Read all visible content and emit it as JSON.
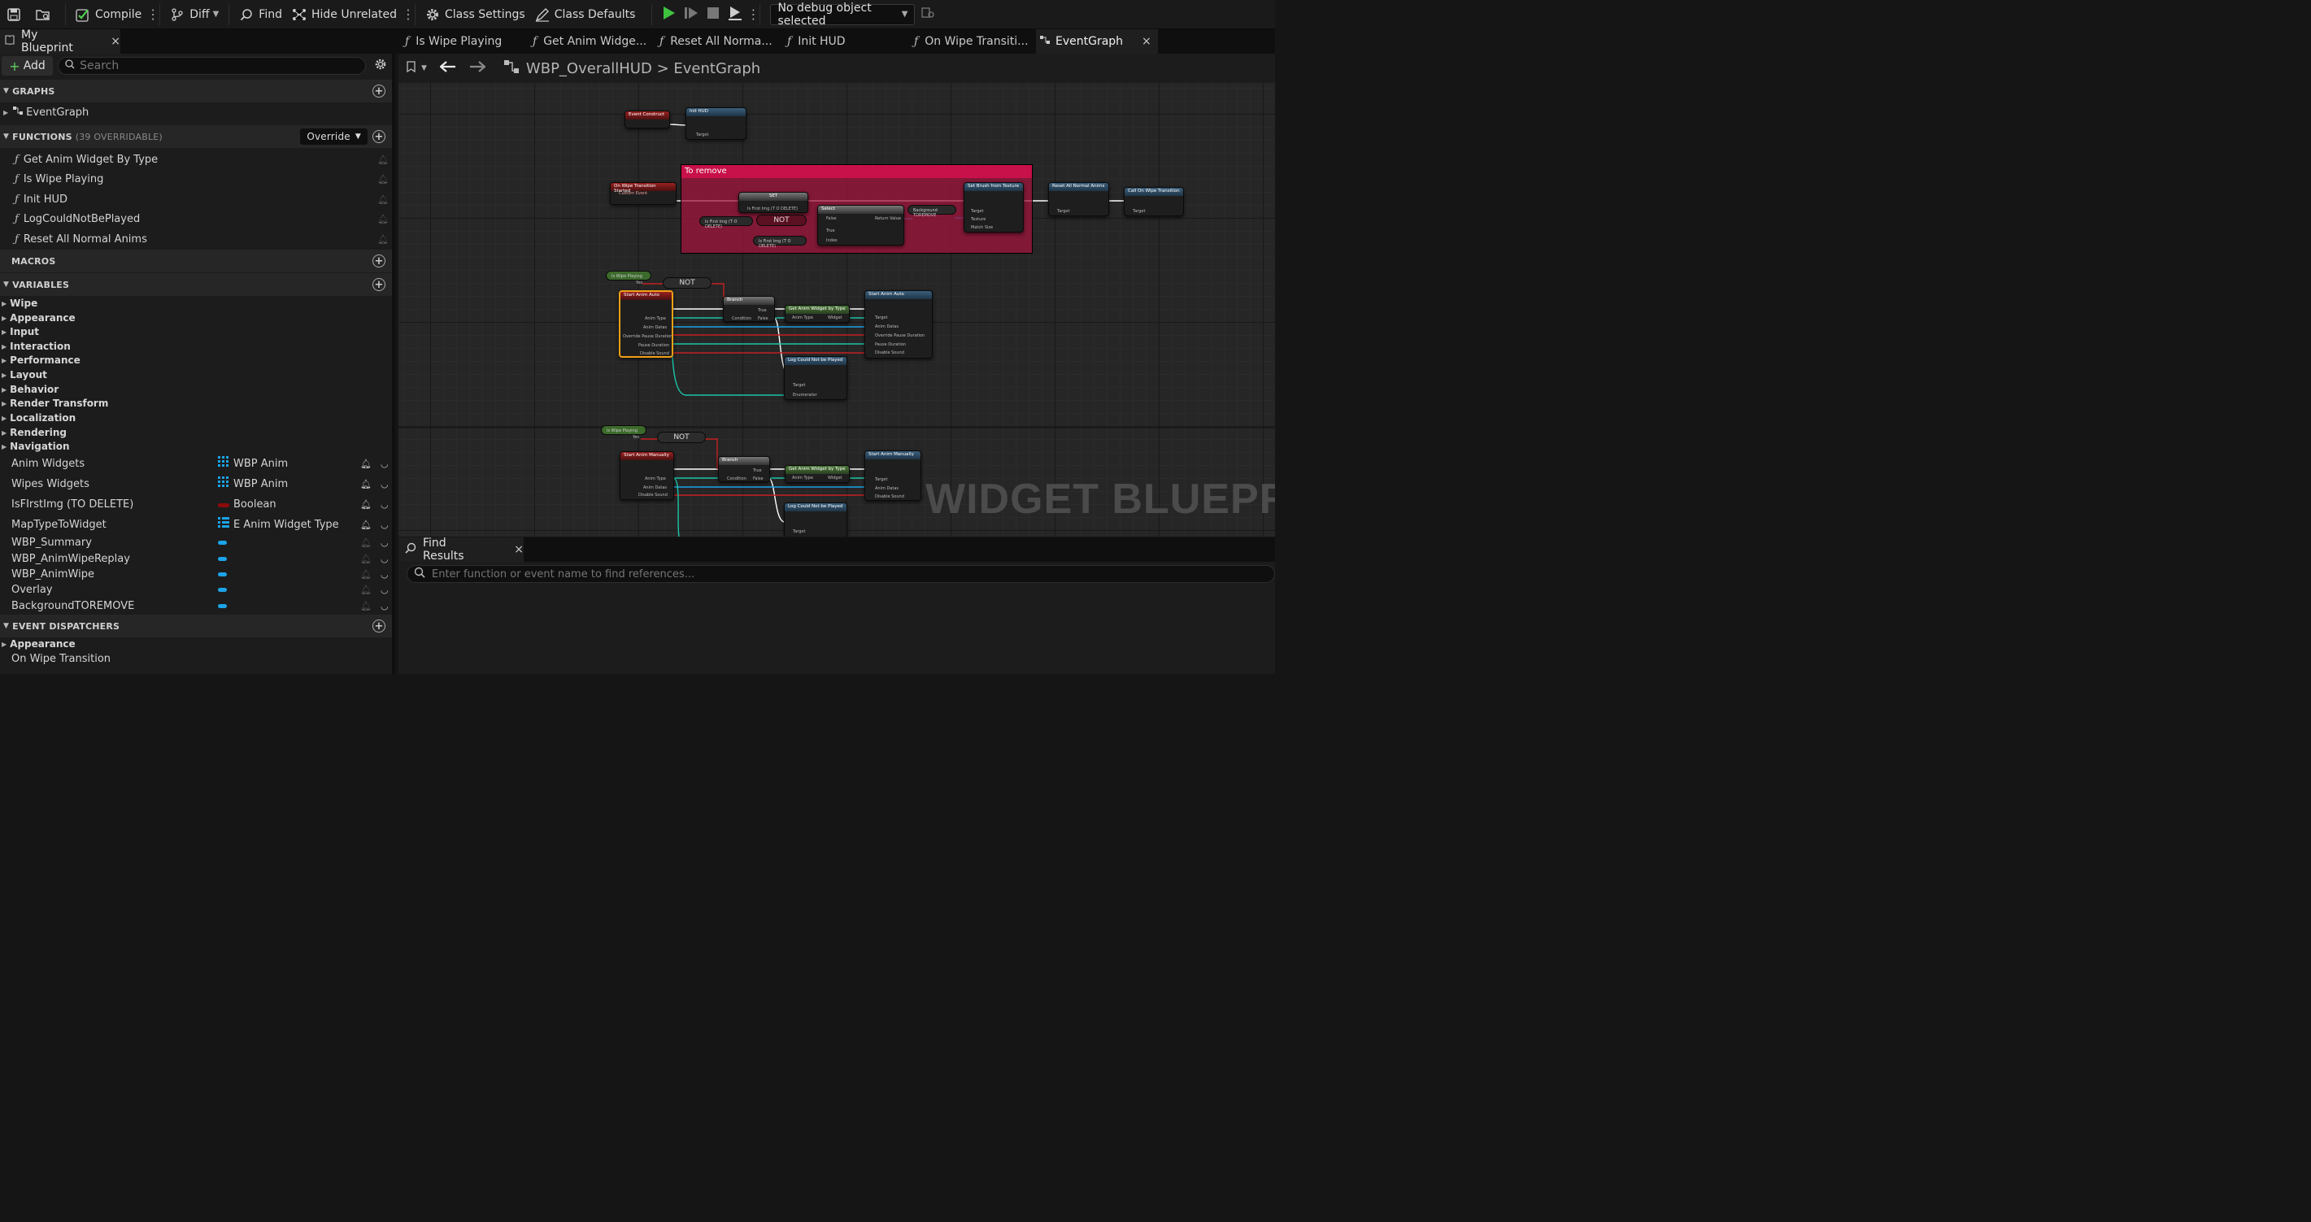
{
  "toolbar": {
    "compile": "Compile",
    "diff": "Diff",
    "find": "Find",
    "hide_unrelated": "Hide Unrelated",
    "class_settings": "Class Settings",
    "class_defaults": "Class Defaults",
    "debug_object": "No debug object selected"
  },
  "tabs": {
    "my_blueprint": "My Blueprint",
    "docs": [
      "Is Wipe Playing",
      "Get Anim Widge...",
      "Reset All Norma...",
      "Init HUD",
      "On Wipe Transiti...",
      "EventGraph"
    ]
  },
  "left": {
    "add": "Add",
    "search_placeholder": "Search",
    "graphs_header": "GRAPHS",
    "graphs": [
      "EventGraph"
    ],
    "functions_header": "FUNCTIONS",
    "functions_sub": "(39 OVERRIDABLE)",
    "override": "Override",
    "functions": [
      "Get Anim Widget By Type",
      "Is Wipe Playing",
      "Init HUD",
      "LogCouldNotBePlayed",
      "Reset All Normal Anims"
    ],
    "macros_header": "MACROS",
    "variables_header": "VARIABLES",
    "categories": [
      "Wipe",
      "Appearance",
      "Input",
      "Interaction",
      "Performance",
      "Layout",
      "Behavior",
      "Render Transform",
      "Localization",
      "Rendering",
      "Navigation"
    ],
    "variables": [
      {
        "name": "Anim Widgets",
        "type": "WBP Anim",
        "icon": "grid-icon",
        "color": "#1ba4e8"
      },
      {
        "name": "Wipes Widgets",
        "type": "WBP Anim",
        "icon": "grid-icon",
        "color": "#1ba4e8"
      },
      {
        "name": "IsFIrstImg (TO DELETE)",
        "type": "Boolean",
        "icon": "bool-pill",
        "color": "#8c0a0a"
      },
      {
        "name": "MapTypeToWidget",
        "type": "E Anim Widget Type",
        "icon": "map-icon",
        "color": "#1ba4e8"
      },
      {
        "name": "WBP_Summary",
        "type": "",
        "icon": "pill",
        "color": "#1ba4e8"
      },
      {
        "name": "WBP_AnimWipeReplay",
        "type": "",
        "icon": "pill",
        "color": "#1ba4e8"
      },
      {
        "name": "WBP_AnimWipe",
        "type": "",
        "icon": "pill",
        "color": "#1ba4e8"
      },
      {
        "name": "Overlay",
        "type": "",
        "icon": "pill",
        "color": "#1ba4e8"
      },
      {
        "name": "BackgroundTOREMOVE",
        "type": "",
        "icon": "pill",
        "color": "#1ba4e8"
      }
    ],
    "dispatchers_header": "EVENT DISPATCHERS",
    "dispatcher_categories": [
      "Appearance"
    ],
    "dispatchers": [
      "On Wipe Transition"
    ]
  },
  "graph": {
    "breadcrumb_bp": "WBP_OverallHUD",
    "breadcrumb_sep": ">",
    "breadcrumb_graph": "EventGraph",
    "comment_title": "To remove",
    "watermark": "WIDGET BLUEPRI",
    "not_label": "NOT",
    "nodes": {
      "event_construct": "Event Construct",
      "init_hud": "Init HUD",
      "on_wipe_started": "On Wipe Transition Started",
      "set": "SET",
      "select": "Select",
      "set_brush": "Set Brush from Texture",
      "reset_anims": "Reset All Normal Anims",
      "call_wipe": "Call On Wipe Transition",
      "is_wipe_playing": "Is Wipe Playing",
      "start_anim_auto": "Start Anim Auto",
      "branch": "Branch",
      "get_anim_widget": "Get Anim Widget by Type",
      "log_not_played": "Log Could Not be Played",
      "start_anim_manually": "Start Anim Manually"
    },
    "pins": {
      "target": "Target",
      "self": "self",
      "custom_event": "Custom Event",
      "is_first": "Is First Img (T O DELETE)",
      "false": "False",
      "true": "True",
      "index": "Index",
      "return_value": "Return Value",
      "bg": "Background TOREMOVE",
      "texture": "Texture",
      "match_size": "Match Size",
      "anim_type": "Anim Type",
      "anim_datas": "Anim Datas",
      "override_pause": "Override Pause Duration",
      "pause_duration": "Pause Duration",
      "disable_sound": "Disable Sound",
      "condition": "Condition",
      "widget": "Widget",
      "enumerator": "Enumerator",
      "yes": "Yes"
    }
  },
  "find": {
    "tab": "Find Results",
    "placeholder": "Enter function or event name to find references..."
  }
}
